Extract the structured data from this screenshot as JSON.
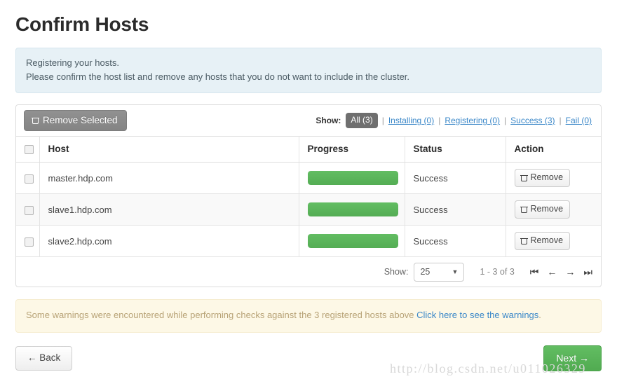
{
  "page_title": "Confirm Hosts",
  "info_alert": {
    "line1": "Registering your hosts.",
    "line2": "Please confirm the host list and remove any hosts that you do not want to include in the cluster."
  },
  "toolbar": {
    "remove_selected_label": "Remove Selected",
    "show_label": "Show:",
    "separator": "|",
    "filters": [
      {
        "label": "All (3)",
        "active": true
      },
      {
        "label": "Installing (0)",
        "active": false
      },
      {
        "label": "Registering (0)",
        "active": false
      },
      {
        "label": "Success (3)",
        "active": false
      },
      {
        "label": "Fail (0)",
        "active": false
      }
    ]
  },
  "table": {
    "columns": [
      "Host",
      "Progress",
      "Status",
      "Action"
    ],
    "rows": [
      {
        "host": "master.hdp.com",
        "progress": 100,
        "status": "Success",
        "action_label": "Remove"
      },
      {
        "host": "slave1.hdp.com",
        "progress": 100,
        "status": "Success",
        "action_label": "Remove"
      },
      {
        "host": "slave2.hdp.com",
        "progress": 100,
        "status": "Success",
        "action_label": "Remove"
      }
    ]
  },
  "pagination": {
    "show_label": "Show:",
    "page_size": "25",
    "range": "1 - 3 of 3",
    "first_icon": "⏮",
    "prev_icon": "←",
    "next_icon": "→",
    "last_icon": "⏭"
  },
  "warning_alert": {
    "text_before": "Some warnings were encountered while performing checks against the 3 registered hosts above ",
    "link_text": "Click here to see the warnings",
    "text_after": "."
  },
  "footer": {
    "back_label": "← Back",
    "next_label": "Next →"
  },
  "watermark": "http://blog.csdn.net/u011026329",
  "colors": {
    "success_green": "#5bb75b",
    "link_blue": "#3a87c8",
    "info_bg": "#e7f1f6",
    "warning_bg": "#fdf8e6",
    "toolbar_gray": "#8a8a8a"
  }
}
